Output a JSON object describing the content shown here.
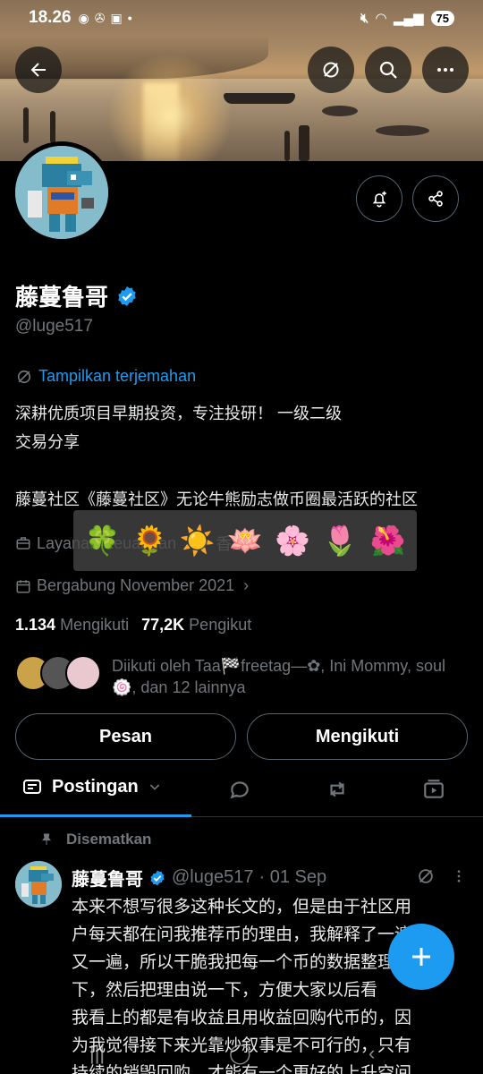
{
  "status_bar": {
    "time": "18.26",
    "battery": "75"
  },
  "header": {
    "back_icon": "arrow-left-icon",
    "translate_icon": "translate-off-icon",
    "search_icon": "search-icon",
    "more_icon": "more-horizontal-icon"
  },
  "profile": {
    "name": "藤蔓鲁哥",
    "handle": "@luge517",
    "translate_label": "Tampilkan terjemahan",
    "bio_lines": [
      "深耕优质项目早期投资，专注投研！ 一级二级",
      "交易分享",
      "",
      "藤蔓社区《藤蔓社区》无论牛熊励志做币圈最活跃的社区"
    ],
    "category": "Layanan Keuangan",
    "location": "香港",
    "joined": "Bergabung November 2021",
    "following_count": "1.134",
    "following_label": "Mengikuti",
    "followers_count": "77,2K",
    "followers_label": "Pengikut",
    "followed_by": "Diikuti oleh Taa🏁freetag—✿, Ini Mommy, soul 🍥, dan 12 lainnya"
  },
  "emoji_overlay": [
    "🍀",
    "🌻",
    "☀️",
    "🪷",
    "🌸",
    "🌷",
    "🌺"
  ],
  "buttons": {
    "message": "Pesan",
    "following": "Mengikuti"
  },
  "tabs": {
    "active": "Postingan"
  },
  "pinned_post": {
    "pinned_label": "Disematkan",
    "author": "藤蔓鲁哥",
    "handle": "@luge517",
    "date": "· 01 Sep",
    "text_lines": [
      "本来不想写很多这种长文的，但是由于社区用",
      "户每天都在问我推荐币的理由，我解释了一遍",
      "又一遍，所以干脆我把每一个币的数据整理一",
      "下，然后把理由说一下，方便大家以后看",
      "我看上的都是有收益且用收益回购代币的，因",
      "为我觉得接下来光靠炒叙事是不可行的，只有",
      "持续的销毁回购，才能有一个更好的上升空间"
    ]
  },
  "colors": {
    "accent": "#1d9bf0",
    "muted": "#71767b",
    "background": "#000000"
  }
}
